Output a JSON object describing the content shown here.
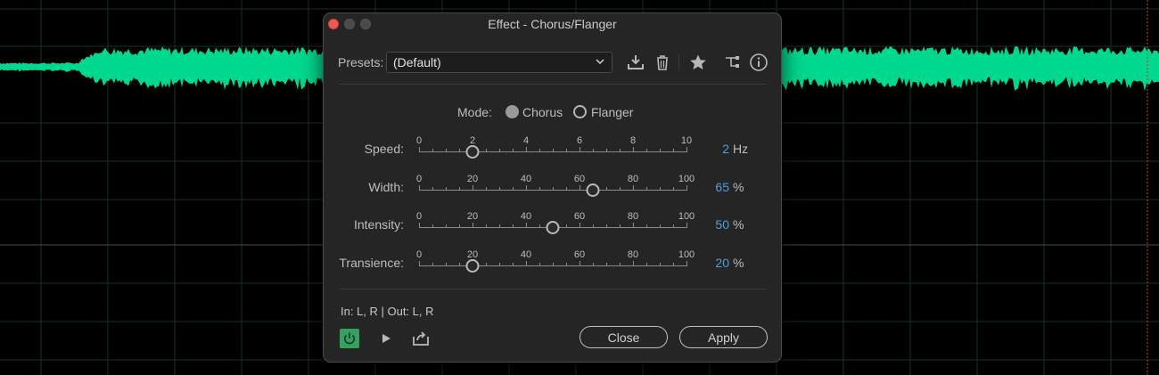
{
  "dialog": {
    "title": "Effect - Chorus/Flanger"
  },
  "presets": {
    "label": "Presets:",
    "selected": "(Default)"
  },
  "toolbar_icons": [
    "download-preset-icon",
    "trash-icon",
    "star-icon",
    "routing-icon",
    "info-icon"
  ],
  "mode": {
    "label": "Mode:",
    "options": [
      "Chorus",
      "Flanger"
    ],
    "selected": "Chorus"
  },
  "sliders": [
    {
      "label": "Speed:",
      "ticks": [
        "0",
        "2",
        "4",
        "6",
        "8",
        "10"
      ],
      "min": 0,
      "max": 10,
      "value": 2,
      "value_text": "2",
      "unit": "Hz"
    },
    {
      "label": "Width:",
      "ticks": [
        "0",
        "20",
        "40",
        "60",
        "80",
        "100"
      ],
      "min": 0,
      "max": 100,
      "value": 65,
      "value_text": "65",
      "unit": "%"
    },
    {
      "label": "Intensity:",
      "ticks": [
        "0",
        "20",
        "40",
        "60",
        "80",
        "100"
      ],
      "min": 0,
      "max": 100,
      "value": 50,
      "value_text": "50",
      "unit": "%"
    },
    {
      "label": "Transience:",
      "ticks": [
        "0",
        "20",
        "40",
        "60",
        "80",
        "100"
      ],
      "min": 0,
      "max": 100,
      "value": 20,
      "value_text": "20",
      "unit": "%"
    }
  ],
  "io": {
    "text": "In: L, R | Out: L, R"
  },
  "footer": {
    "close_label": "Close",
    "apply_label": "Apply"
  },
  "colors": {
    "waveform": "#00d88f",
    "accent_value": "#4d9de0",
    "power_on": "#37a060"
  }
}
